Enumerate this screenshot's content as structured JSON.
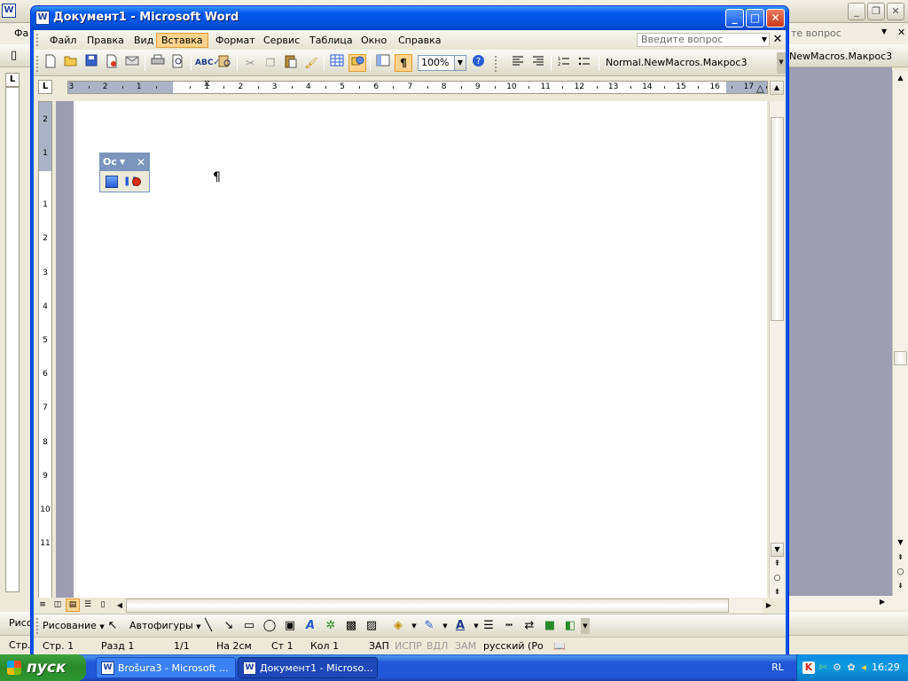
{
  "background_window": {
    "menu_partial": "Фа",
    "ask_partial": "те вопрос",
    "macro_partial": "NewMacros.Макрос3",
    "draw_partial": "Рисо",
    "status_partial": "Стр."
  },
  "window": {
    "title": "Документ1 - Microsoft Word",
    "icon": "W",
    "minimize": "_",
    "maximize": "□",
    "close": "✕"
  },
  "menu": {
    "items": [
      "Файл",
      "Правка",
      "Вид",
      "Вставка",
      "Формат",
      "Сервис",
      "Таблица",
      "Окно",
      "Справка"
    ],
    "active": "Вставка",
    "ask_placeholder": "Введите вопрос",
    "close": "✕"
  },
  "toolbar": {
    "zoom": "100%",
    "macro": "Normal.NewMacros.Макрос3",
    "icons": [
      "new-document-icon",
      "open-icon",
      "save-icon",
      "permission-icon",
      "print-icon",
      "print-preview-icon",
      "spelling-icon",
      "research-icon",
      "cut-icon",
      "copy-icon",
      "paste-icon",
      "format-painter-icon",
      "table-icon",
      "drawing-icon",
      "document-map-icon",
      "show-formatting-icon",
      "help-icon",
      "align-left-icon",
      "align-right-icon",
      "numbering-icon",
      "bullets-icon"
    ]
  },
  "ruler": {
    "tab_selector": "L",
    "left_numbers": [
      "3",
      "2",
      "1"
    ],
    "right_numbers": [
      "1",
      "2",
      "3",
      "4",
      "5",
      "6",
      "7",
      "8",
      "9",
      "10",
      "11",
      "12",
      "13",
      "14",
      "15",
      "16",
      "17"
    ],
    "vertical_numbers": [
      "2",
      "1",
      "1",
      "2",
      "3",
      "4",
      "5",
      "6",
      "7",
      "8",
      "9",
      "10",
      "11"
    ]
  },
  "document": {
    "paragraph_mark": "¶"
  },
  "macro_toolbar": {
    "title": "Ос",
    "caret": "▼",
    "close": "✕"
  },
  "drawing_toolbar": {
    "drawing_menu": "Рисование",
    "autoshapes_menu": "Автофигуры"
  },
  "statusbar": {
    "page": "Стр.  1",
    "section": "Разд  1",
    "pages": "1/1",
    "at": "На  2см",
    "line": "Ст  1",
    "column": "Кол  1",
    "rec": "ЗАП",
    "trk": "ИСПР",
    "ext": "ВДЛ",
    "ovr": "ЗАМ",
    "language": "русский (Ро"
  },
  "taskbar": {
    "start": "пуск",
    "tasks": [
      {
        "label": "Brošura3 - Microsoft ...",
        "active": false
      },
      {
        "label": "Документ1 - Microso...",
        "active": true
      }
    ],
    "language": "RL",
    "clock": "16:29"
  },
  "colors": {
    "titlebar_blue": "#0058ee",
    "active_menu": "#ffd38d",
    "taskbar_blue": "#2157d7",
    "start_green": "#2f972f"
  }
}
